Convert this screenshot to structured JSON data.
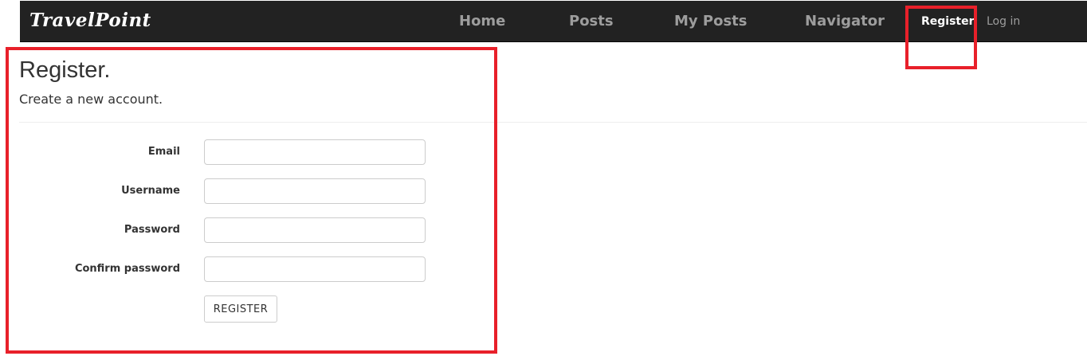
{
  "navbar": {
    "brand": "TravelPoint",
    "links": [
      {
        "label": "Home"
      },
      {
        "label": "Posts"
      },
      {
        "label": "My Posts"
      },
      {
        "label": "Navigator"
      }
    ],
    "register_label": "Register",
    "login_label": "Log in"
  },
  "page": {
    "title": "Register.",
    "subtitle": "Create a new account."
  },
  "form": {
    "fields": [
      {
        "label": "Email",
        "value": "",
        "placeholder": ""
      },
      {
        "label": "Username",
        "value": "",
        "placeholder": ""
      },
      {
        "label": "Password",
        "value": "",
        "placeholder": ""
      },
      {
        "label": "Confirm password",
        "value": "",
        "placeholder": ""
      }
    ],
    "submit_label": "REGISTER"
  },
  "colors": {
    "navbar_bg": "#222222",
    "nav_link": "#9d9d9d",
    "nav_active": "#ffffff",
    "highlight": "#e8202a"
  }
}
